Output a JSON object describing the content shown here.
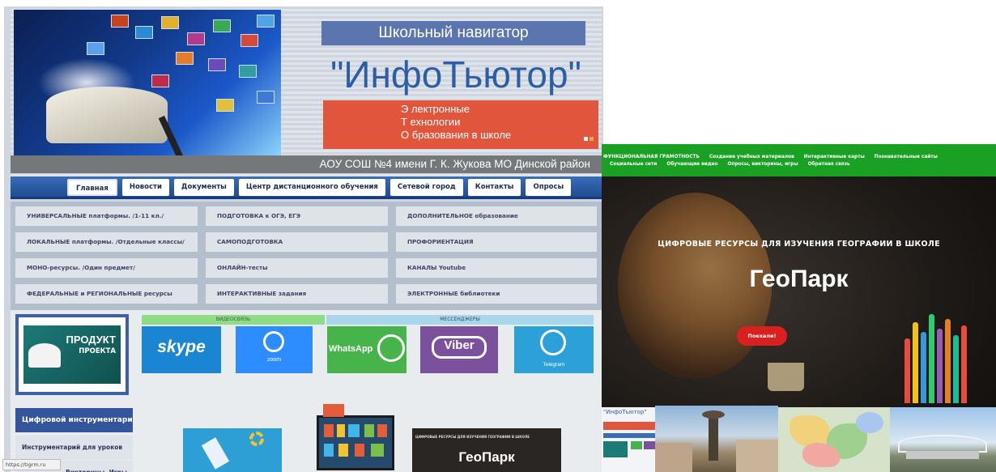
{
  "left": {
    "banner": {
      "subtitle": "Школьный навигатор",
      "title": "\"ИнфоТьютор\"",
      "acronym_lines": [
        "Э лектронные",
        "Т ехнологии",
        "О бразования в школе"
      ],
      "school": "АОУ СОШ №4 имени Г. К. Жукова МО Динской район"
    },
    "nav": [
      "Главная",
      "Новости",
      "Документы",
      "Центр дистанционного обучения",
      "Сетевой город",
      "Контакты",
      "Опросы"
    ],
    "menu": {
      "col1": [
        "УНИВЕРСАЛЬНЫЕ платформы. /1-11 кл./",
        "ЛОКАЛЬНЫЕ платформы. /Отдельные классы/",
        "МОНО-ресурсы. /Один предмет/",
        "ФЕДЕРАЛЬНЫЕ и РЕГИОНАЛЬНЫЕ ресурсы"
      ],
      "col2": [
        "ПОДГОТОВКА к ОГЭ, ЕГЭ",
        "САМОПОДГОТОВКА",
        "ОНЛАЙН-тесты",
        "ИНТЕРАКТИВНЫЕ задания"
      ],
      "col3": [
        "ДОПОЛНИТЕЛЬНОЕ образование",
        "ПРОФОРИЕНТАЦИЯ",
        "КАНАЛЫ Youtube",
        "ЭЛЕКТРОННЫЕ библиотеки"
      ]
    },
    "produkt": {
      "line1": "ПРОДУКТ",
      "line2": "ПРОЕКТА"
    },
    "sidebar": [
      "Цифровой инструментарий",
      "Инструментарий для уроков",
      "Викторины. Игры"
    ],
    "sections": {
      "video": "ВИДЕОСВЯЗЬ",
      "messengers": "МЕССЕНДЖЕРЫ"
    },
    "tiles": {
      "skype": "skype",
      "zoom": "zoom",
      "whatsapp": "WhatsApp",
      "viber": "Viber",
      "telegram": "Telegram"
    },
    "thumb_geo": {
      "caption": "ЦИФРОВЫЕ РЕСУРСЫ ДЛЯ ИЗУЧЕНИЯ ГЕОГРАФИИ В ШКОЛЕ",
      "title": "ГеоПарк"
    },
    "status_url": "https://tigrm.ru"
  },
  "right": {
    "nav_row1": [
      "ФУНКЦИОНАЛЬНАЯ ГРАМОТНОСТЬ",
      "Создание учебных материалов",
      "Интерактивные карты",
      "Познавательные сайты"
    ],
    "nav_row2": [
      "Социальные сети",
      "Обучающие видео",
      "Опросы, викторины, игры",
      "Обратная связь"
    ],
    "subtitle": "ЦИФРОВЫЕ РЕСУРСЫ ДЛЯ ИЗУЧЕНИЯ ГЕОГРАФИИ В ШКОЛЕ",
    "title": "ГеоПарк",
    "button": "Поехали!",
    "thumb_label": "\"ИнфоТьютор\""
  },
  "colors": {
    "nav_blue": "#2c5ea5",
    "red_banner": "#e2553d",
    "green_nav": "#1aa124",
    "red_button": "#d9201e",
    "skype": "#1a86d3",
    "zoom": "#2d8cff",
    "whatsapp": "#46b34b",
    "viber": "#7b519d",
    "telegram": "#2ba0d9"
  }
}
